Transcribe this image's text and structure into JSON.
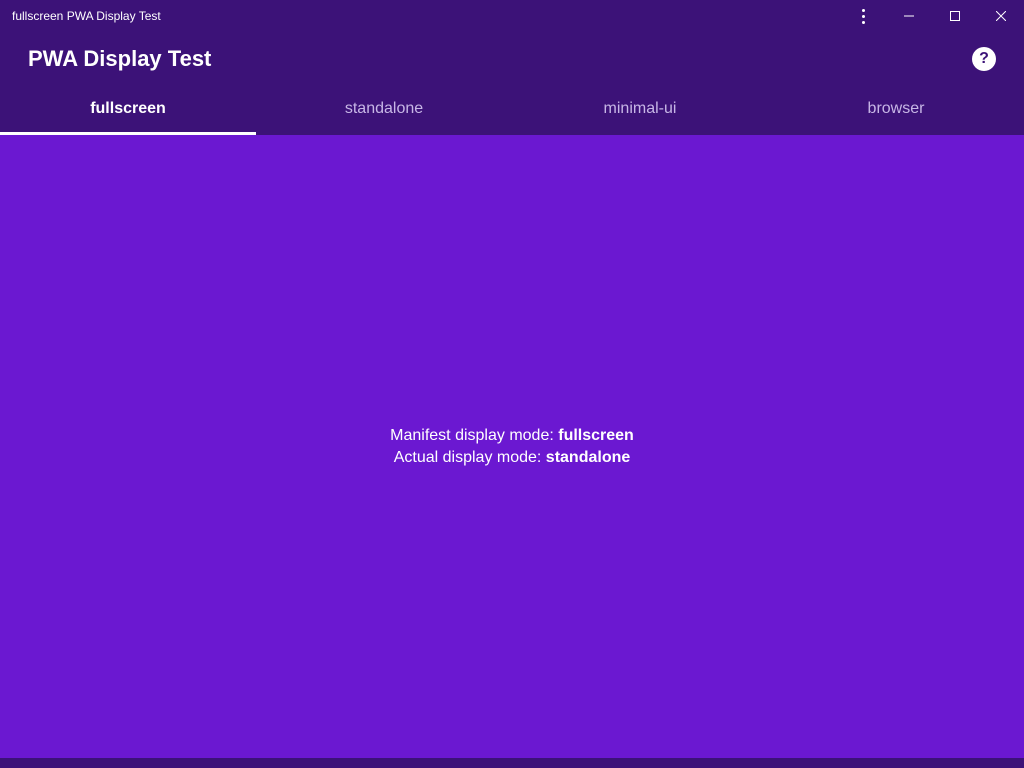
{
  "window": {
    "title": "fullscreen PWA Display Test"
  },
  "header": {
    "title": "PWA Display Test"
  },
  "tabs": [
    {
      "label": "fullscreen",
      "active": true
    },
    {
      "label": "standalone",
      "active": false
    },
    {
      "label": "minimal-ui",
      "active": false
    },
    {
      "label": "browser",
      "active": false
    }
  ],
  "content": {
    "manifest_label": "Manifest display mode: ",
    "manifest_value": "fullscreen",
    "actual_label": "Actual display mode: ",
    "actual_value": "standalone"
  },
  "colors": {
    "titlebar_bg": "#3c1278",
    "content_bg": "#6b18d1"
  }
}
